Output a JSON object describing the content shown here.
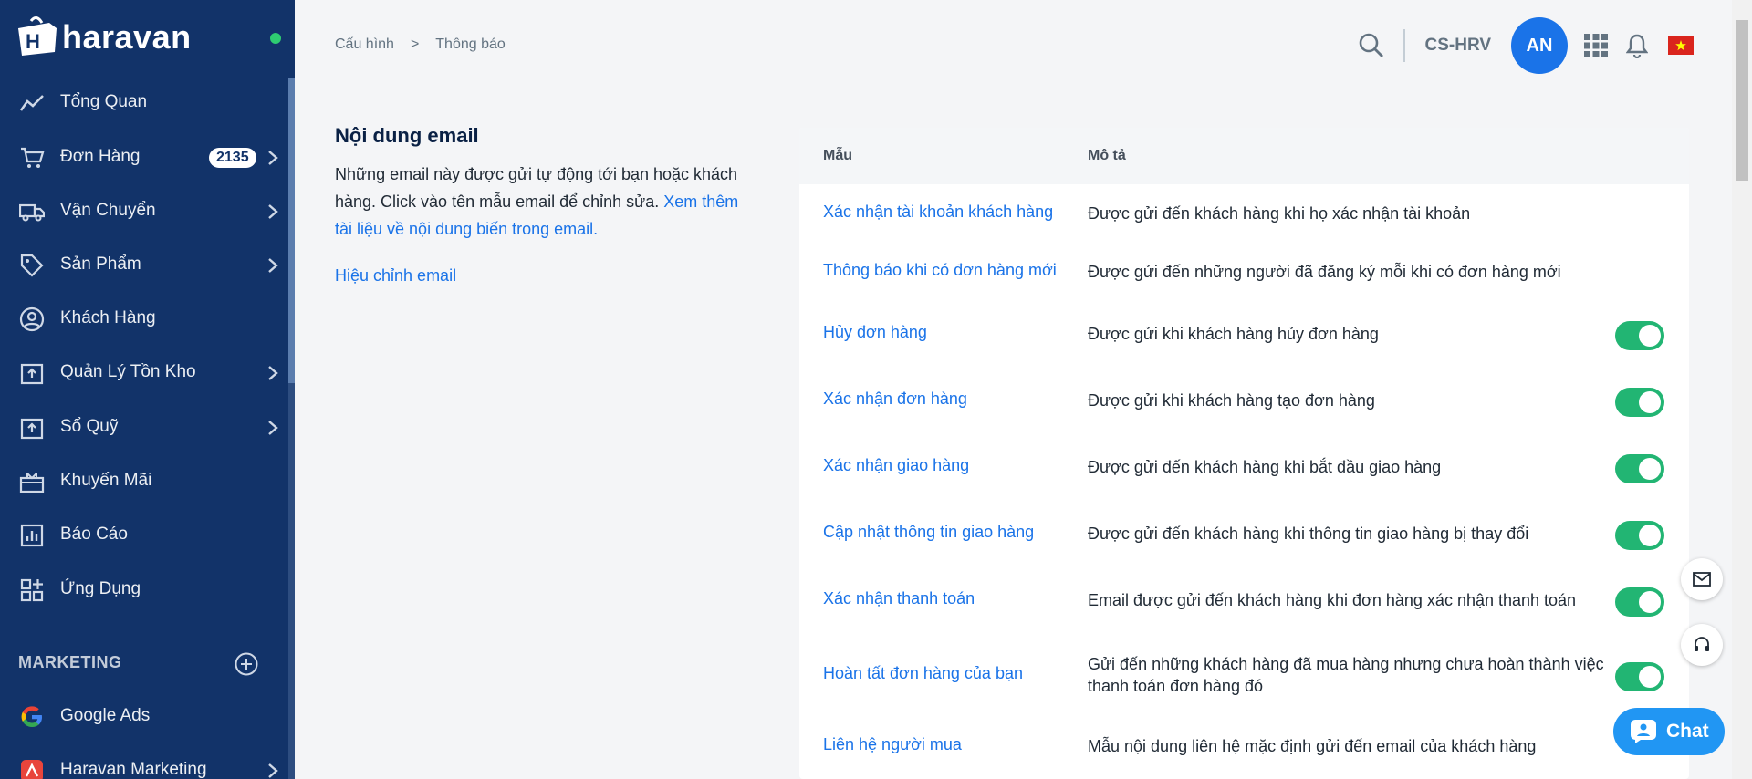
{
  "app": {
    "name": "haravan"
  },
  "sidebar": {
    "items": [
      {
        "label": "Tổng Quan",
        "icon": "trend-line-icon"
      },
      {
        "label": "Đơn Hàng",
        "icon": "cart-icon",
        "badge": "2135",
        "has_children": true
      },
      {
        "label": "Vận Chuyển",
        "icon": "truck-icon",
        "has_children": true
      },
      {
        "label": "Sản Phẩm",
        "icon": "tag-icon",
        "has_children": true
      },
      {
        "label": "Khách Hàng",
        "icon": "user-circle-icon"
      },
      {
        "label": "Quản Lý Tồn Kho",
        "icon": "inventory-icon",
        "has_children": true
      },
      {
        "label": "Sổ Quỹ",
        "icon": "cashbook-icon",
        "has_children": true
      },
      {
        "label": "Khuyến Mãi",
        "icon": "gift-icon"
      },
      {
        "label": "Báo Cáo",
        "icon": "report-icon"
      },
      {
        "label": "Ứng Dụng",
        "icon": "apps-icon"
      }
    ],
    "marketing": {
      "title": "MARKETING",
      "items": [
        {
          "label": "Google Ads",
          "icon": "google-icon"
        },
        {
          "label": "Haravan Marketing",
          "icon": "haravan-marketing-icon",
          "has_children": true
        }
      ]
    }
  },
  "breadcrumb": {
    "parent": "Cấu hình",
    "separator": ">",
    "current": "Thông báo"
  },
  "topbar": {
    "store_name": "CS-HRV",
    "avatar_initials": "AN"
  },
  "intro": {
    "title": "Nội dung email",
    "text": "Những email này được gửi tự động tới bạn hoặc khách hàng. Click vào tên mẫu email để chỉnh sửa.",
    "link": "Xem thêm tài liệu về nội dung biến trong email.",
    "edit_link": "Hiệu chỉnh email"
  },
  "table": {
    "col_template": "Mẫu",
    "col_description": "Mô tả",
    "rows": [
      {
        "name": "Xác nhận tài khoản khách hàng",
        "desc": "Được gửi đến khách hàng khi họ xác nhận tài khoản",
        "toggle": null
      },
      {
        "name": "Thông báo khi có đơn hàng mới",
        "desc": "Được gửi đến những người đã đăng ký mỗi khi có đơn hàng mới",
        "toggle": null
      },
      {
        "name": "Hủy đơn hàng",
        "desc": "Được gửi khi khách hàng hủy đơn hàng",
        "toggle": true
      },
      {
        "name": "Xác nhận đơn hàng",
        "desc": "Được gửi khi khách hàng tạo đơn hàng",
        "toggle": true
      },
      {
        "name": "Xác nhận giao hàng",
        "desc": "Được gửi đến khách hàng khi bắt đầu giao hàng",
        "toggle": true
      },
      {
        "name": "Cập nhật thông tin giao hàng",
        "desc": "Được gửi đến khách hàng khi thông tin giao hàng bị thay đổi",
        "toggle": true
      },
      {
        "name": "Xác nhận thanh toán",
        "desc": "Email được gửi đến khách hàng khi đơn hàng xác nhận thanh toán",
        "toggle": true
      },
      {
        "name": "Hoàn tất đơn hàng của bạn",
        "desc": "Gửi đến những khách hàng đã mua hàng nhưng chưa hoàn thành việc thanh toán đơn hàng đó",
        "toggle": true
      },
      {
        "name": "Liên hệ người mua",
        "desc": "Mẫu nội dung liên hệ mặc định gửi đến email của khách hàng",
        "toggle": null
      }
    ]
  },
  "chat": {
    "label": "Chat"
  },
  "colors": {
    "sidebar": "#123369",
    "accent": "#1a73e8",
    "toggle_on": "#22b573",
    "online": "#2ecc71"
  }
}
